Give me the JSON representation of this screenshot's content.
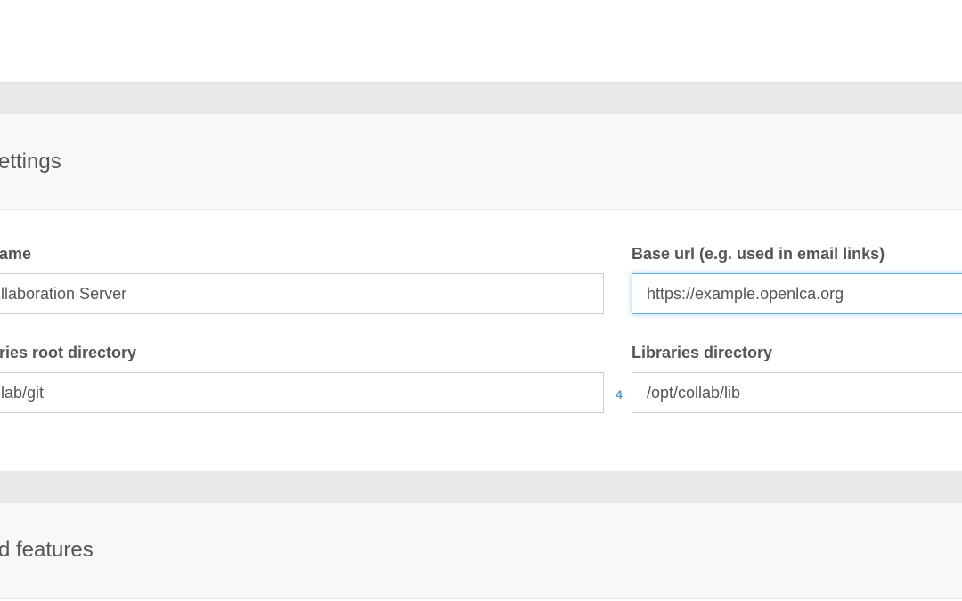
{
  "section1": {
    "title": "ettings",
    "fields": {
      "name": {
        "label": "ame",
        "value": "llaboration Server"
      },
      "base_url": {
        "label": "Base url (e.g. used in email links)",
        "value": "https://example.openlca.org"
      },
      "repos_dir": {
        "label": "ries root directory",
        "value": "lab/git"
      },
      "libs_dir": {
        "label": "Libraries directory",
        "value": "/opt/collab/lib"
      }
    },
    "indicator": "4"
  },
  "section2": {
    "title": "d features"
  },
  "colors": {
    "focus_border": "#66afe9",
    "indicator": "#5b9bd5",
    "heading_bg": "#f7f8fa",
    "page_bg": "#e8e9ea"
  }
}
